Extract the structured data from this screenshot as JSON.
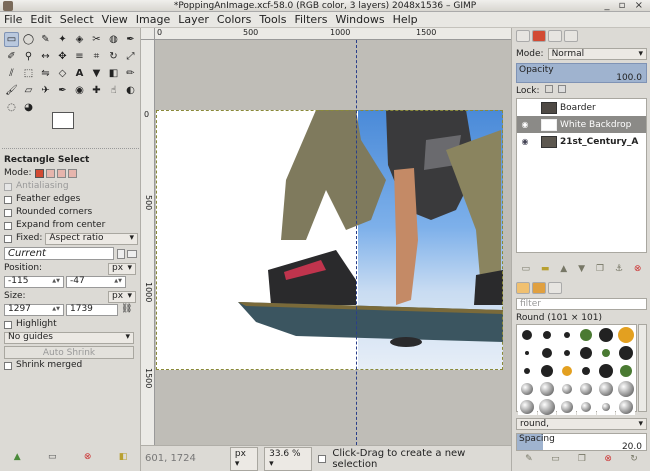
{
  "window": {
    "title": "*PoppingAnImage.xcf-58.0 (RGB color, 3 layers) 2048x1536 – GIMP",
    "controls": "_ ▫ ×"
  },
  "menu": [
    "File",
    "Edit",
    "Select",
    "View",
    "Image",
    "Layer",
    "Colors",
    "Tools",
    "Filters",
    "Windows",
    "Help"
  ],
  "toolbox": {
    "tool_icons": [
      "rect-select-icon",
      "ellipse-select-icon",
      "lasso-icon",
      "fuzzy-select-icon",
      "by-color-select-icon",
      "scissors-icon",
      "foreground-select-icon",
      "paths-icon",
      "color-picker-icon",
      "zoom-icon",
      "measure-icon",
      "move-icon",
      "align-icon",
      "crop-icon",
      "rotate-icon",
      "scale-icon",
      "shear-icon",
      "perspective-icon",
      "flip-icon",
      "cage-icon",
      "text-icon",
      "bucket-fill-icon",
      "blend-icon",
      "pencil-icon",
      "paintbrush-icon",
      "eraser-icon",
      "airbrush-icon",
      "ink-icon",
      "clone-icon",
      "heal-icon",
      "smudge-icon",
      "dodge-icon",
      "blur-icon",
      "color-icon"
    ],
    "options": {
      "title": "Rectangle Select",
      "mode_label": "Mode:",
      "antialiasing": "Antialiasing",
      "feather": "Feather edges",
      "rounded": "Rounded corners",
      "expand": "Expand from center",
      "fixed_label": "Fixed:",
      "fixed_value": "Aspect ratio",
      "current": "Current",
      "position_label": "Position:",
      "position_unit": "px",
      "pos_x": "-115",
      "pos_y": "-47",
      "size_label": "Size:",
      "size_unit": "px",
      "size_w": "1297",
      "size_h": "1739",
      "highlight": "Highlight",
      "guides": "No guides",
      "auto_shrink": "Auto Shrink",
      "shrink_merged": "Shrink merged"
    }
  },
  "rulers": {
    "top": [
      "0",
      "500",
      "1000",
      "1500"
    ],
    "left": [
      "0",
      "500",
      "1000",
      "1500"
    ]
  },
  "status": {
    "coords": "601, 1724",
    "unit": "px",
    "zoom": "33.6 %",
    "message": "Click-Drag to create a new selection"
  },
  "layers": {
    "mode_label": "Mode:",
    "mode": "Normal",
    "opacity_label": "Opacity",
    "opacity": "100.0",
    "lock_label": "Lock:",
    "items": [
      {
        "name": "Boarder"
      },
      {
        "name": "White Backdrop"
      },
      {
        "name": "21st_Century_A"
      }
    ]
  },
  "brushes": {
    "filter_placeholder": "filter",
    "name": "Round (101 × 101)",
    "preset": "round,",
    "spacing_label": "Spacing",
    "spacing": "20.0",
    "spacing_level": 0.2
  }
}
